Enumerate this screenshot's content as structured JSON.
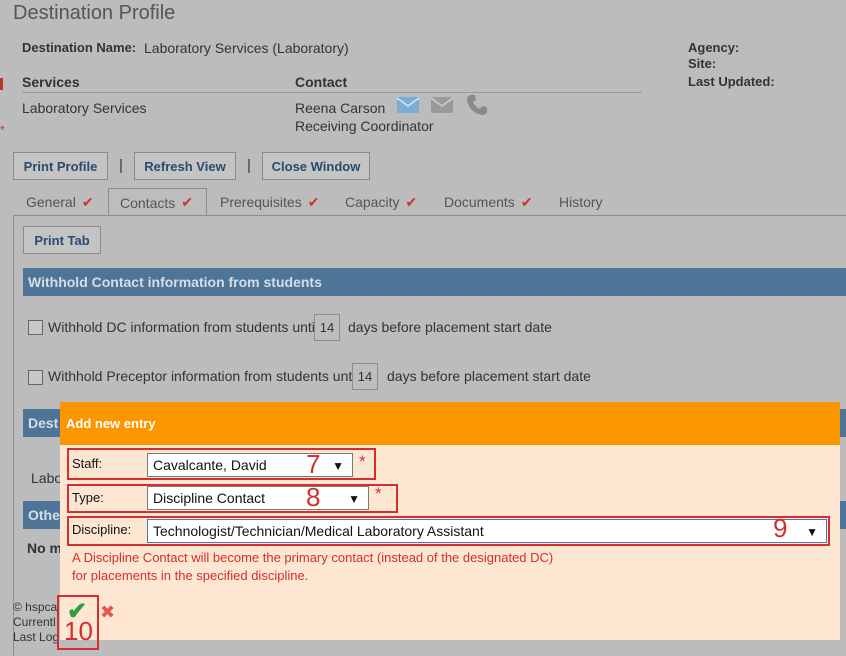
{
  "page": {
    "title": "Destination Profile",
    "dest_name_label": "Destination Name:",
    "dest_name_value": "Laboratory Services (Laboratory)",
    "agency_label": "Agency:",
    "site_label": "Site:",
    "last_updated_label": "Last Updated:",
    "services_header": "Services",
    "contact_header": "Contact",
    "services_value": "Laboratory Services",
    "contact_name": "Reena Carson",
    "contact_role": "Receiving Coordinator"
  },
  "toolbar": {
    "print_profile": "Print Profile",
    "refresh_view": "Refresh View",
    "close_window": "Close Window",
    "separator": "|"
  },
  "tabs": [
    {
      "label": "General",
      "check": "✔"
    },
    {
      "label": "Contacts",
      "check": "✔"
    },
    {
      "label": "Prerequisites",
      "check": "✔"
    },
    {
      "label": "Capacity",
      "check": "✔"
    },
    {
      "label": "Documents",
      "check": "✔"
    },
    {
      "label": "History",
      "check": ""
    }
  ],
  "panel": {
    "print_tab": "Print Tab",
    "withhold_bar": "Withhold Contact information from students",
    "withhold_dc_pre": "Withhold DC information from students until",
    "withhold_dc_days": "14",
    "withhold_dc_post": "days before placement start date",
    "withhold_prec_pre": "Withhold Preceptor information from students until",
    "withhold_prec_days": "14",
    "withhold_prec_post": "days before placement start date",
    "bar2_partial": "Dest",
    "labo_partial": "Labo",
    "bar3_partial": "Othe",
    "no_partial": "No m"
  },
  "footer_partial": {
    "line1": "© hspca",
    "line2": "Currentl",
    "line3": "Last Log"
  },
  "modal": {
    "title": "Add new entry",
    "staff_label": "Staff:",
    "staff_value": "Cavalcante, David",
    "type_label": "Type:",
    "type_value": "Discipline Contact",
    "discipline_label": "Discipline:",
    "discipline_value": "Technologist/Technician/Medical Laboratory Assistant",
    "required_mark": "*",
    "dropdown_arrow": "▼",
    "note_line1": "A Discipline Contact will become the primary contact (instead of the designated DC)",
    "note_line2": "for placements in the specified discipline.",
    "confirm_icon": "✔",
    "cancel_icon": "✖"
  },
  "annotations": {
    "staff_num": "7",
    "type_num": "8",
    "discipline_num": "9",
    "confirm_num": "10"
  },
  "colors": {
    "modal_header": "#fb9600",
    "modal_body": "#fde7d2",
    "annotation_red": "#d32f2f",
    "section_bar": "#4e7597",
    "confirm_green": "#2e9e3e"
  }
}
